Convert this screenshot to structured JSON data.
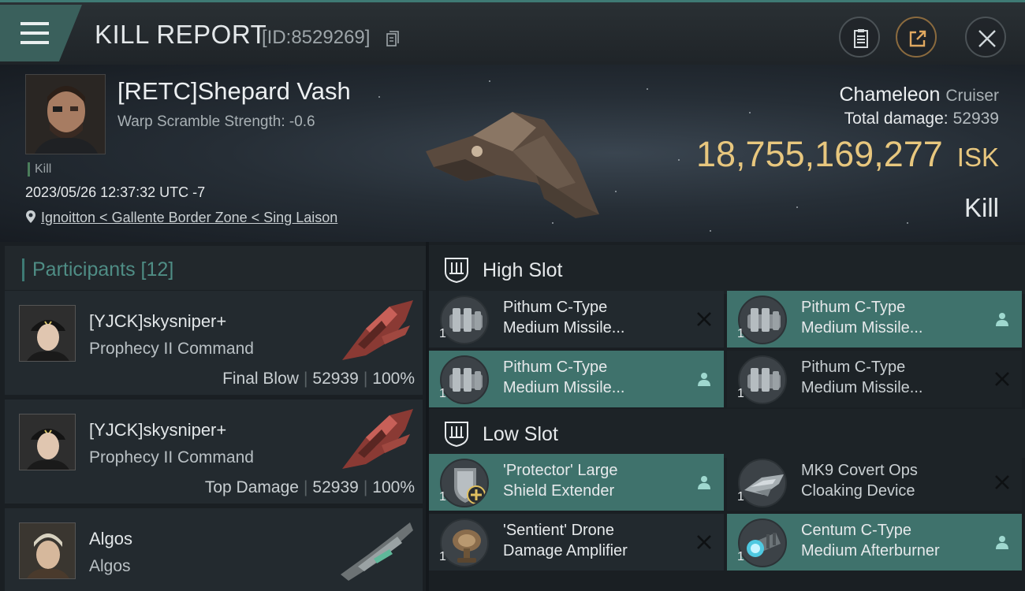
{
  "header": {
    "title": "KILL REPORT",
    "report_id": "[ID:8529269]"
  },
  "victim": {
    "name": "[RETC]Shepard Vash",
    "warp_scramble": "Warp Scramble Strength: -0.6",
    "tag": "Kill",
    "datetime": "2023/05/26 12:37:32 UTC -7",
    "location": "Ignoitton < Gallente Border Zone < Sing Laison",
    "ship": "Chameleon",
    "ship_class": "Cruiser",
    "total_damage_label": "Total damage:",
    "total_damage": "52939",
    "isk_value": "18,755,169,277",
    "isk_unit": "ISK",
    "outcome": "Kill"
  },
  "participants": {
    "title": "Participants [12]",
    "items": [
      {
        "name": "[YJCK]skysniper+",
        "ship": "Prophecy II Command",
        "role": "Final Blow",
        "damage": "52939",
        "percent": "100%"
      },
      {
        "name": "[YJCK]skysniper+",
        "ship": "Prophecy II Command",
        "role": "Top Damage",
        "damage": "52939",
        "percent": "100%"
      },
      {
        "name": "Algos",
        "ship": "Algos"
      }
    ]
  },
  "slots": {
    "high": {
      "title": "High Slot",
      "items": [
        {
          "name": "Pithum C-Type\nMedium Missile...",
          "qty": "1",
          "status": "destroyed"
        },
        {
          "name": "Pithum C-Type\nMedium Missile...",
          "qty": "1",
          "status": "dropped"
        },
        {
          "name": "Pithum C-Type\nMedium Missile...",
          "qty": "1",
          "status": "dropped"
        },
        {
          "name": "Pithum C-Type\nMedium Missile...",
          "qty": "1",
          "status": "destroyed"
        }
      ]
    },
    "low": {
      "title": "Low Slot",
      "items": [
        {
          "name": "'Protector' Large\nShield Extender",
          "qty": "1",
          "status": "dropped"
        },
        {
          "name": "MK9 Covert Ops\nCloaking Device",
          "qty": "1",
          "status": "destroyed"
        },
        {
          "name": "'Sentient' Drone\nDamage Amplifier",
          "qty": "1",
          "status": "destroyed"
        },
        {
          "name": "Centum C-Type\nMedium Afterburner",
          "qty": "1",
          "status": "dropped"
        }
      ]
    }
  },
  "colors": {
    "accent_teal": "#3f726c",
    "isk_gold": "#e8c77e"
  }
}
